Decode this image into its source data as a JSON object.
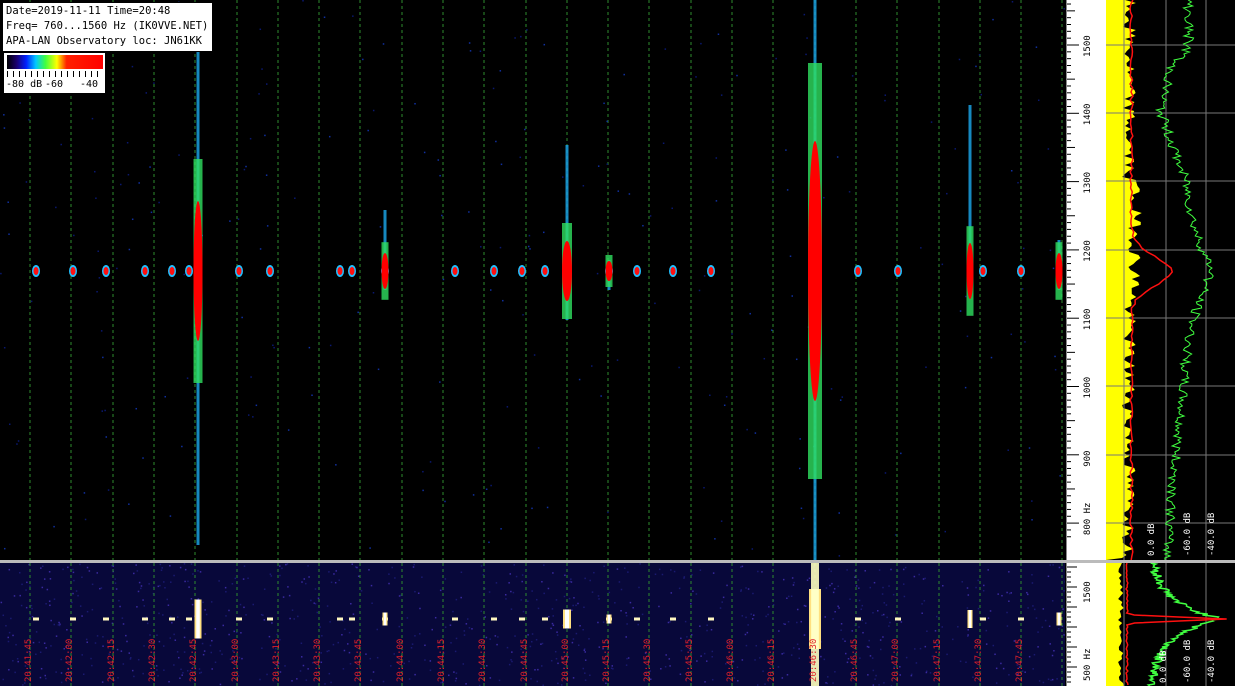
{
  "info": {
    "line1": "Date=2019-11-11 Time=20:48",
    "line2": "Freq= 760...1560 Hz (IK0VVE.NET)",
    "line3": "APA-LAN Observatory loc: JN61KK"
  },
  "legend": {
    "low": "-80 dB",
    "mid": "-60",
    "high": "-40"
  },
  "freq_scale": {
    "labels": [
      "1500",
      "1400",
      "1300",
      "1200",
      "1100",
      "1000",
      "900",
      "800 Hz"
    ]
  },
  "freq_scale_wide": {
    "labels": [
      "1500",
      "500 Hz"
    ]
  },
  "spectrum_labels": {
    "main": [
      "0.0 dB",
      "-60.0 dB",
      "-40.0 dB"
    ],
    "wide": [
      "0.0 dB",
      "-60.0 dB",
      "-40.0 dB"
    ]
  },
  "time_labels": [
    "20:41:45",
    "20:42:00",
    "20:42:15",
    "20:42:30",
    "20:42:45",
    "20:43:00",
    "20:43:15",
    "20:43:30",
    "20:43:45",
    "20:44:00",
    "20:44:15",
    "20:44:30",
    "20:44:45",
    "20:45:00",
    "20:45:15",
    "20:45:30",
    "20:45:45",
    "20:46:00",
    "20:46:15",
    "20:46:30",
    "20:46:45",
    "20:47:00",
    "20:47:15",
    "20:47:30",
    "20:47:45"
  ],
  "colors": {
    "accent_signal": "#ff0000",
    "grid_line": "#2e8b2e",
    "time_label": "#e0202a",
    "spectrum_yellow": "#ffff00",
    "spectrum_green": "#40ff40"
  }
}
